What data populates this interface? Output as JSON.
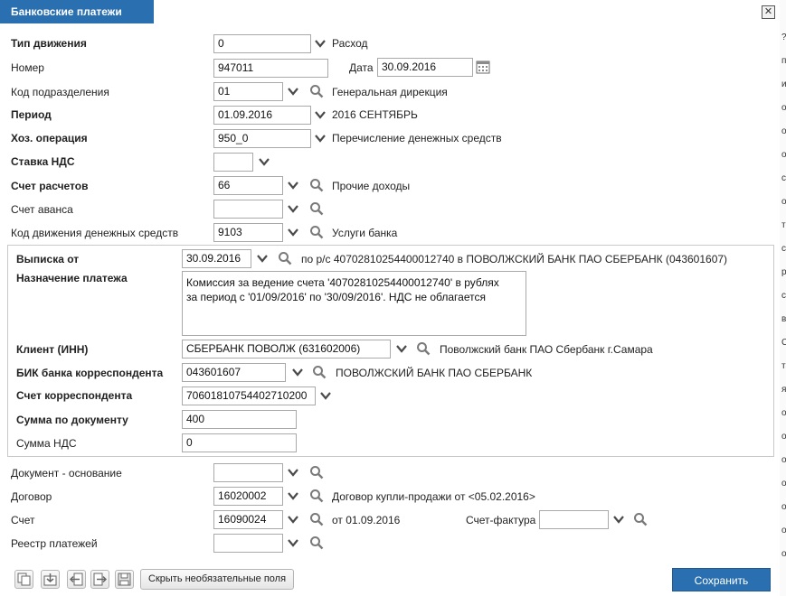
{
  "window": {
    "title": "Банковские платежи",
    "close_glyph": "✕"
  },
  "fields": {
    "movement_type": {
      "label": "Тип движения",
      "value": "0",
      "desc": "Расход"
    },
    "number": {
      "label": "Номер",
      "value": "947011"
    },
    "date": {
      "label": "Дата",
      "value": "30.09.2016"
    },
    "dept_code": {
      "label": "Код подразделения",
      "value": "01",
      "desc": "Генеральная дирекция"
    },
    "period": {
      "label": "Период",
      "value": "01.09.2016",
      "desc": "2016 СЕНТЯБРЬ"
    },
    "operation": {
      "label": "Хоз. операция",
      "value": "950_0",
      "desc": "Перечисление денежных средств"
    },
    "vat_rate": {
      "label": "Ставка НДС",
      "value": ""
    },
    "account": {
      "label": "Счет расчетов",
      "value": "66",
      "desc": "Прочие доходы"
    },
    "advance_account": {
      "label": "Счет аванса",
      "value": ""
    },
    "cashflow_code": {
      "label": "Код движения денежных средств",
      "value": "9103",
      "desc": "Услуги банка"
    }
  },
  "group": {
    "statement": {
      "label": "Выписка от",
      "value": "30.09.2016",
      "desc": "по р/с 40702810254400012740 в ПОВОЛЖСКИЙ БАНК ПАО СБЕРБАНК (043601607)"
    },
    "purpose": {
      "label": "Назначение платежа",
      "line1": "Комиссия за ведение счета '40702810254400012740' в рублях",
      "line2": "за период с '01/09/2016' по '30/09/2016'. НДС не облагается"
    },
    "client": {
      "label": "Клиент (ИНН)",
      "value": "СБЕРБАНК ПОВОЛЖ (631602006)",
      "desc": "Поволжский банк ПАО Сбербанк г.Самара"
    },
    "bik": {
      "label": "БИК банка корреспондента",
      "value": "043601607",
      "desc": "ПОВОЛЖСКИЙ БАНК ПАО СБЕРБАНК"
    },
    "corr_account": {
      "label": "Счет корреспондента",
      "value": "70601810754402710200"
    },
    "amount": {
      "label": "Сумма по документу",
      "value": "400"
    },
    "vat_amount": {
      "label": "Сумма НДС",
      "value": "0"
    }
  },
  "bottom": {
    "basis_doc": {
      "label": "Документ - основание",
      "value": ""
    },
    "contract": {
      "label": "Договор",
      "value": "16020002",
      "desc": "Договор купли-продажи от <05.02.2016>"
    },
    "invoice": {
      "label": "Счет",
      "value": "16090024",
      "desc": "от 01.09.2016"
    },
    "invoice_factura": {
      "label": "Счет-фактура",
      "value": ""
    },
    "payments_registry": {
      "label": "Реестр платежей",
      "value": ""
    }
  },
  "toolbar": {
    "icons": [
      "copy-icon",
      "import-icon",
      "prev-icon",
      "next-icon",
      "save-disk-icon"
    ],
    "hide_label": "Скрыть необязательные поля",
    "save_label": "Сохранить"
  },
  "right_strip_marks": [
    "?",
    "пе",
    "ив",
    "ос",
    "от",
    "ос",
    "сц",
    "ой",
    "тв",
    "ст",
    "р.",
    "ст",
    "в",
    "С",
    "та",
    "яз",
    "ос",
    "о:",
    "ос",
    "ос",
    "ос",
    "ос",
    "ос"
  ],
  "colors": {
    "accent": "#2a6fb0",
    "dropdown_arrow": "#4a4a4a",
    "search_icon": "#7a7a7a"
  }
}
